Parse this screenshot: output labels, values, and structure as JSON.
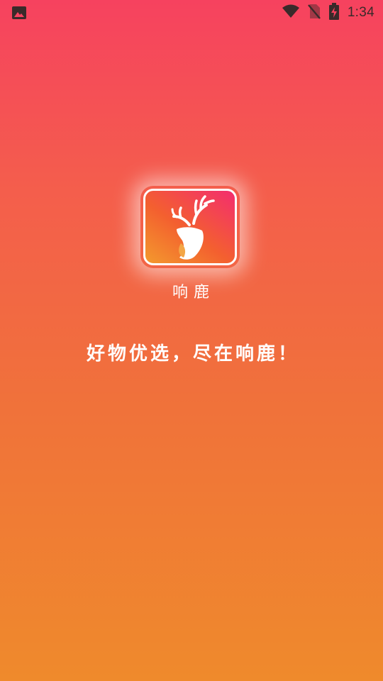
{
  "status_bar": {
    "left_icon": "image-notification-icon",
    "icons": [
      "wifi-icon",
      "no-sim-icon",
      "battery-charging-icon"
    ],
    "time": "1:34"
  },
  "splash": {
    "logo_icon": "deer-antler-logo-icon",
    "app_name": "响鹿",
    "slogan": "好物优选，尽在响鹿！"
  },
  "colors": {
    "gradient_top": "#f6425f",
    "gradient_bottom": "#ef8a2c",
    "icon_gradient_start": "#f39a2d",
    "icon_gradient_end": "#f32d6f",
    "text": "#ffffff"
  }
}
